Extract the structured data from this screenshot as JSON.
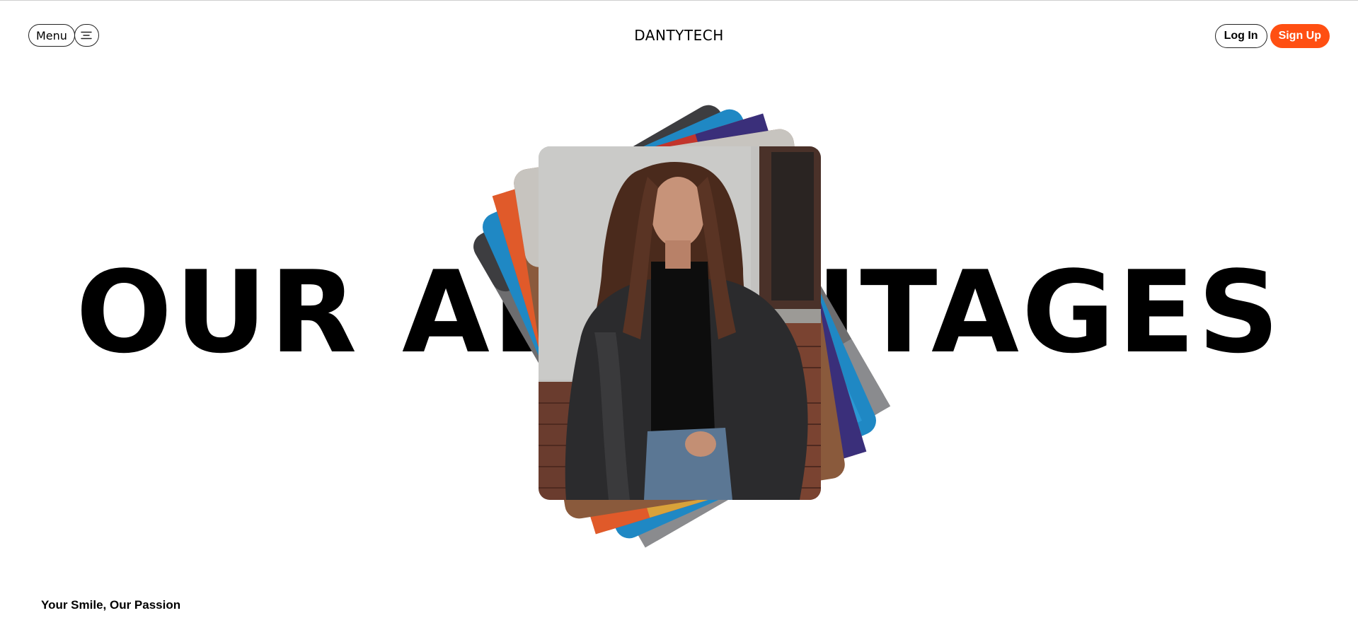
{
  "header": {
    "menu_label": "Menu",
    "menu_icon": "hamburger-icon",
    "brand": "DANTYTECH",
    "login_label": "Log In",
    "signup_label": "Sign Up"
  },
  "hero": {
    "heading": "OUR ADVANTAGES",
    "heading_visible_left": "OUR AD",
    "heading_visible_right": "NTAGES"
  },
  "footer": {
    "tagline": "Your Smile, Our Passion"
  },
  "colors": {
    "accent": "#ff4f12",
    "text": "#000000",
    "background": "#ffffff"
  }
}
